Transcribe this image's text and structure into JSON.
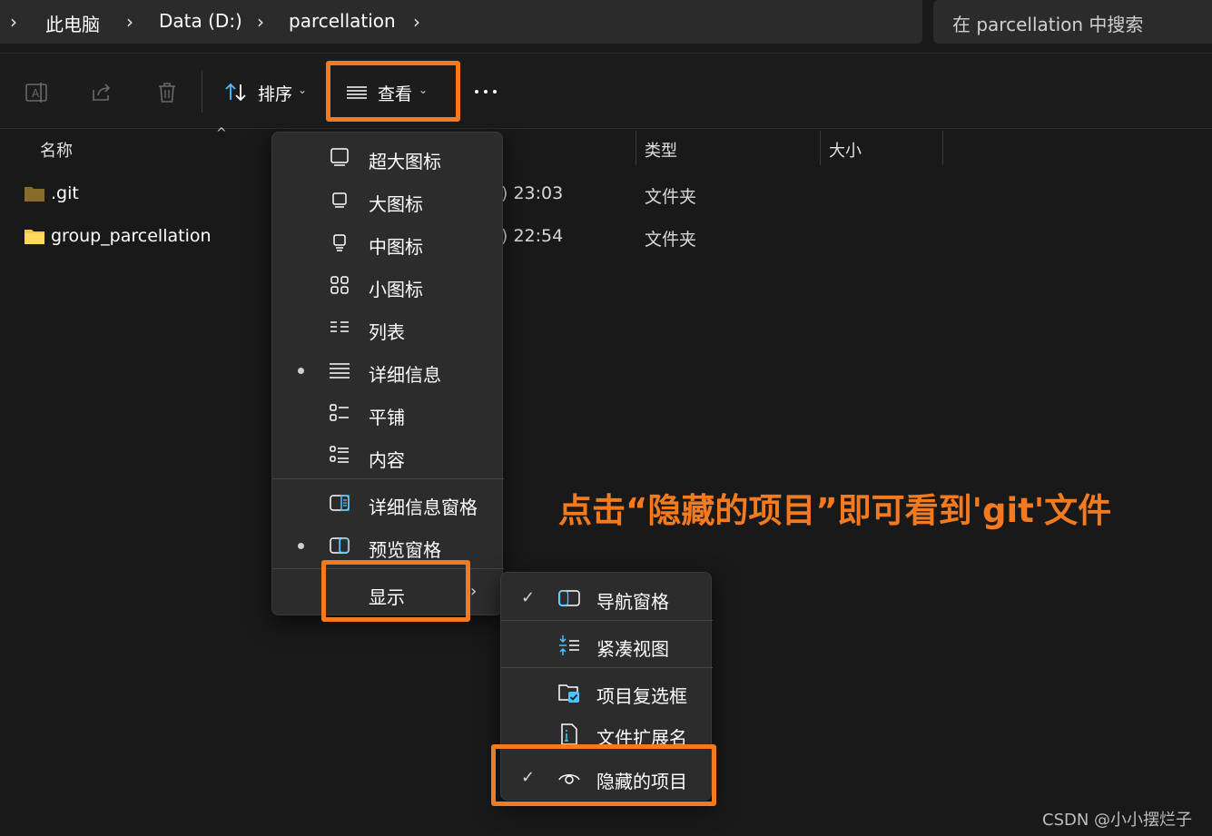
{
  "breadcrumb": {
    "items": [
      "此电脑",
      "Data (D:)",
      "parcellation"
    ]
  },
  "search": {
    "placeholder": "在 parcellation 中搜索"
  },
  "toolbar": {
    "sort_label": "排序",
    "view_label": "查看",
    "icons": [
      "rename-icon",
      "share-icon",
      "delete-icon",
      "sort-icon",
      "view-icon",
      "more-icon"
    ]
  },
  "columns": {
    "name": "名称",
    "type": "类型",
    "size": "大小"
  },
  "files": [
    {
      "name": ".git",
      "date_fragment": ") 23:03",
      "type": "文件夹"
    },
    {
      "name": "group_parcellation",
      "date_fragment": ") 22:54",
      "type": "文件夹"
    }
  ],
  "view_menu": {
    "items": [
      {
        "label": "超大图标",
        "icon": "extra-large-icons-icon",
        "selected": false
      },
      {
        "label": "大图标",
        "icon": "large-icons-icon",
        "selected": false
      },
      {
        "label": "中图标",
        "icon": "medium-icons-icon",
        "selected": false
      },
      {
        "label": "小图标",
        "icon": "small-icons-icon",
        "selected": false
      },
      {
        "label": "列表",
        "icon": "list-icon",
        "selected": false
      },
      {
        "label": "详细信息",
        "icon": "details-icon",
        "selected": true
      },
      {
        "label": "平铺",
        "icon": "tiles-icon",
        "selected": false
      },
      {
        "label": "内容",
        "icon": "content-icon",
        "selected": false
      },
      {
        "label": "详细信息窗格",
        "icon": "details-pane-icon",
        "selected": false
      },
      {
        "label": "预览窗格",
        "icon": "preview-pane-icon",
        "selected": true
      },
      {
        "label": "显示",
        "icon": "",
        "selected": false
      }
    ]
  },
  "show_menu": {
    "items": [
      {
        "label": "导航窗格",
        "icon": "navigation-pane-icon",
        "checked": true
      },
      {
        "label": "紧凑视图",
        "icon": "compact-view-icon",
        "checked": false
      },
      {
        "label": "项目复选框",
        "icon": "item-checkbox-icon",
        "checked": false
      },
      {
        "label": "文件扩展名",
        "icon": "file-extension-icon",
        "checked": false
      },
      {
        "label": "隐藏的项目",
        "icon": "hidden-items-icon",
        "checked": true
      }
    ]
  },
  "annotation": "点击“隐藏的项目”即可看到'git'文件",
  "watermark": "CSDN @小小摆烂子",
  "colors": {
    "accent": "#f47a20",
    "background": "#191919",
    "menu_bg": "#2c2c2c",
    "icon_blue": "#4cc2ff"
  }
}
